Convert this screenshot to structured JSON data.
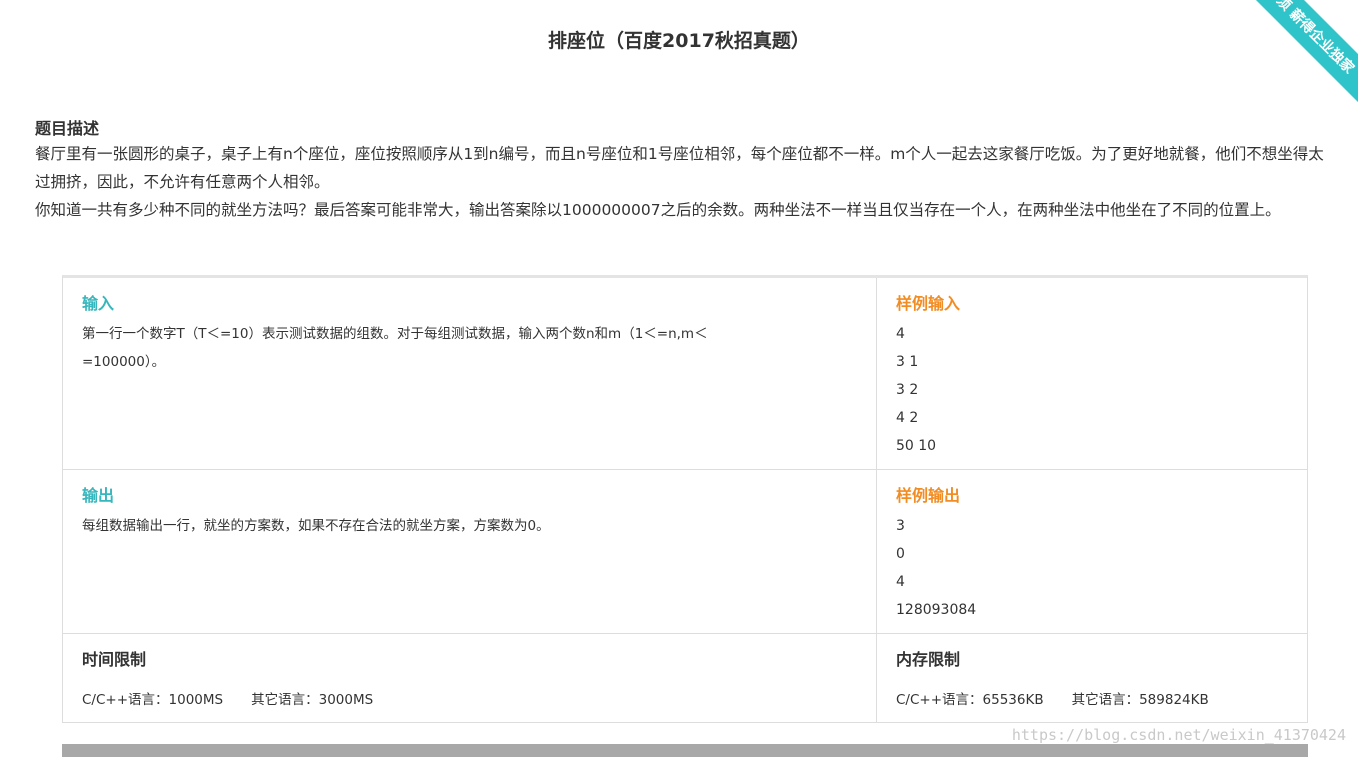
{
  "page": {
    "title": "排座位（百度2017秋招真题）",
    "ribbon_text": "载必须 薪得企业独家"
  },
  "description": {
    "heading": "题目描述",
    "paragraphs": [
      "餐厅里有一张圆形的桌子，桌子上有n个座位，座位按照顺序从1到n编号，而且n号座位和1号座位相邻，每个座位都不一样。m个人一起去这家餐厅吃饭。为了更好地就餐，他们不想坐得太过拥挤，因此，不允许有任意两个人相邻。",
      "你知道一共有多少种不同的就坐方法吗？最后答案可能非常大，输出答案除以1000000007之后的余数。两种坐法不一样当且仅当存在一个人，在两种坐法中他坐在了不同的位置上。"
    ]
  },
  "input": {
    "title": "输入",
    "text": "第一行一个数字T（T＜=10）表示测试数据的组数。对于每组测试数据，输入两个数n和m（1＜=n,m＜=100000）。"
  },
  "sample_input": {
    "title": "样例输入",
    "lines": [
      "4",
      "3 1",
      "3 2",
      "4 2",
      "50 10"
    ]
  },
  "output": {
    "title": "输出",
    "text": "每组数据输出一行，就坐的方案数，如果不存在合法的就坐方案，方案数为0。"
  },
  "sample_output": {
    "title": "样例输出",
    "lines": [
      "3",
      "0",
      "4",
      "128093084"
    ]
  },
  "time_limit": {
    "title": "时间限制",
    "cpp": "C/C++语言：1000MS",
    "other": "其它语言：3000MS"
  },
  "memory_limit": {
    "title": "内存限制",
    "cpp": "C/C++语言：65536KB",
    "other": "其它语言：589824KB"
  },
  "watermark": "https://blog.csdn.net/weixin_41370424",
  "colors": {
    "teal": "#36b7bd",
    "orange": "#f28d24",
    "ribbon": "#2ec4c9"
  }
}
